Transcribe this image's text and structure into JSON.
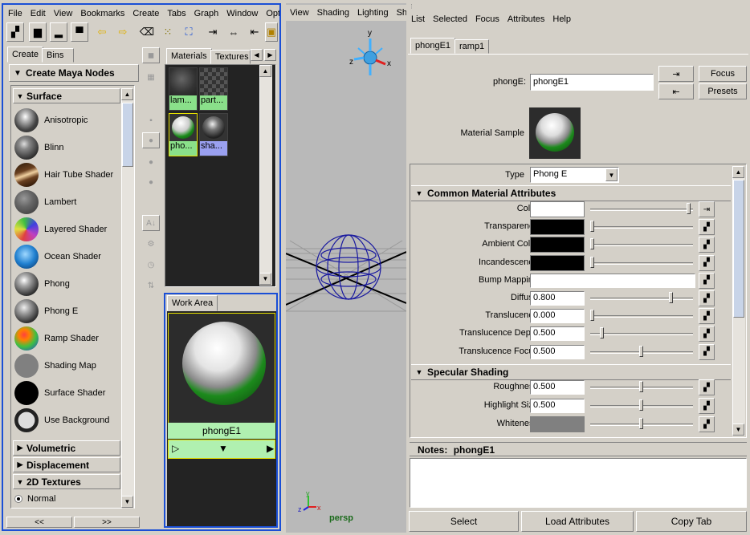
{
  "hypershade_menu": [
    "File",
    "Edit",
    "View",
    "Bookmarks",
    "Create",
    "Tabs",
    "Graph",
    "Window",
    "Options"
  ],
  "viewport_menu": [
    "View",
    "Shading",
    "Lighting",
    "Sh"
  ],
  "attr_menu": [
    "List",
    "Selected",
    "Focus",
    "Attributes",
    "Help"
  ],
  "create_tabs": {
    "create": "Create",
    "bins": "Bins"
  },
  "create_header": "Create Maya Nodes",
  "sections": {
    "surface": "Surface",
    "volumetric": "Volumetric",
    "displacement": "Displacement",
    "textures2d": "2D Textures"
  },
  "nodes": [
    {
      "name": "Anisotropic",
      "icon": "anisotropic-swatch-icon"
    },
    {
      "name": "Blinn",
      "icon": "blinn-swatch-icon"
    },
    {
      "name": "Hair Tube Shader",
      "icon": "hair-tube-swatch-icon"
    },
    {
      "name": "Lambert",
      "icon": "lambert-swatch-icon"
    },
    {
      "name": "Layered Shader",
      "icon": "layered-swatch-icon"
    },
    {
      "name": "Ocean Shader",
      "icon": "ocean-swatch-icon"
    },
    {
      "name": "Phong",
      "icon": "phong-swatch-icon"
    },
    {
      "name": "Phong E",
      "icon": "phonge-swatch-icon"
    },
    {
      "name": "Ramp Shader",
      "icon": "ramp-swatch-icon"
    },
    {
      "name": "Shading Map",
      "icon": "shading-map-swatch-icon"
    },
    {
      "name": "Surface Shader",
      "icon": "surface-shader-swatch-icon"
    },
    {
      "name": "Use Background",
      "icon": "use-background-swatch-icon"
    }
  ],
  "radio_normal": "Normal",
  "nav_prev": "<<",
  "nav_next": ">>",
  "mat_tabs": {
    "materials": "Materials",
    "textures": "Textures"
  },
  "thumbs": [
    {
      "label": "lam..."
    },
    {
      "label": "part..."
    },
    {
      "label": "pho..."
    },
    {
      "label": "sha..."
    }
  ],
  "work_area_tab": "Work Area",
  "work_node": "phongE1",
  "viewport_label": "persp",
  "attr_tabs": {
    "phong": "phongE1",
    "ramp": "ramp1"
  },
  "node_field_label": "phongE:",
  "node_field_value": "phongE1",
  "focus_btn": "Focus",
  "presets_btn": "Presets",
  "material_sample_label": "Material Sample",
  "type_label": "Type",
  "type_value": "Phong E",
  "common_header": "Common Material Attributes",
  "specular_header": "Specular Shading",
  "common_attrs": [
    {
      "label": "Color",
      "swatch": "#ffffff"
    },
    {
      "label": "Transparency",
      "swatch": "#000000"
    },
    {
      "label": "Ambient Color",
      "swatch": "#000000"
    },
    {
      "label": "Incandescence",
      "swatch": "#000000"
    },
    {
      "label": "Bump Mapping"
    },
    {
      "label": "Diffuse",
      "value": "0.800",
      "level": 0.8
    },
    {
      "label": "Translucence",
      "value": "0.000",
      "level": 0.0
    },
    {
      "label": "Translucence Depth",
      "value": "0.500",
      "level": 0.1
    },
    {
      "label": "Translucence Focus",
      "value": "0.500",
      "level": 0.5
    }
  ],
  "spec_attrs": [
    {
      "label": "Roughness",
      "value": "0.500",
      "level": 0.5
    },
    {
      "label": "Highlight Size",
      "value": "0.500",
      "level": 0.5
    },
    {
      "label": "Whiteness",
      "swatch": "#808080",
      "level": 0.5
    }
  ],
  "notes_label": "Notes:",
  "notes_node": "phongE1",
  "bottom_buttons": {
    "select": "Select",
    "load": "Load Attributes",
    "copy": "Copy Tab"
  }
}
